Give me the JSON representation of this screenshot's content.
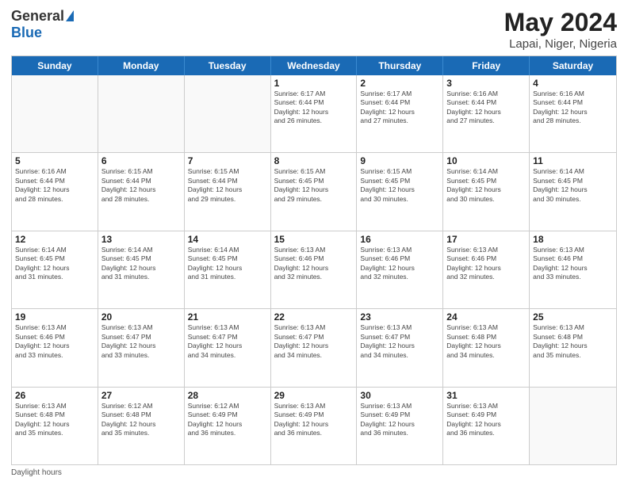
{
  "logo": {
    "general": "General",
    "blue": "Blue"
  },
  "title": "May 2024",
  "subtitle": "Lapai, Niger, Nigeria",
  "header_days": [
    "Sunday",
    "Monday",
    "Tuesday",
    "Wednesday",
    "Thursday",
    "Friday",
    "Saturday"
  ],
  "weeks": [
    [
      {
        "date": "",
        "info": ""
      },
      {
        "date": "",
        "info": ""
      },
      {
        "date": "",
        "info": ""
      },
      {
        "date": "1",
        "info": "Sunrise: 6:17 AM\nSunset: 6:44 PM\nDaylight: 12 hours\nand 26 minutes."
      },
      {
        "date": "2",
        "info": "Sunrise: 6:17 AM\nSunset: 6:44 PM\nDaylight: 12 hours\nand 27 minutes."
      },
      {
        "date": "3",
        "info": "Sunrise: 6:16 AM\nSunset: 6:44 PM\nDaylight: 12 hours\nand 27 minutes."
      },
      {
        "date": "4",
        "info": "Sunrise: 6:16 AM\nSunset: 6:44 PM\nDaylight: 12 hours\nand 28 minutes."
      }
    ],
    [
      {
        "date": "5",
        "info": "Sunrise: 6:16 AM\nSunset: 6:44 PM\nDaylight: 12 hours\nand 28 minutes."
      },
      {
        "date": "6",
        "info": "Sunrise: 6:15 AM\nSunset: 6:44 PM\nDaylight: 12 hours\nand 28 minutes."
      },
      {
        "date": "7",
        "info": "Sunrise: 6:15 AM\nSunset: 6:44 PM\nDaylight: 12 hours\nand 29 minutes."
      },
      {
        "date": "8",
        "info": "Sunrise: 6:15 AM\nSunset: 6:45 PM\nDaylight: 12 hours\nand 29 minutes."
      },
      {
        "date": "9",
        "info": "Sunrise: 6:15 AM\nSunset: 6:45 PM\nDaylight: 12 hours\nand 30 minutes."
      },
      {
        "date": "10",
        "info": "Sunrise: 6:14 AM\nSunset: 6:45 PM\nDaylight: 12 hours\nand 30 minutes."
      },
      {
        "date": "11",
        "info": "Sunrise: 6:14 AM\nSunset: 6:45 PM\nDaylight: 12 hours\nand 30 minutes."
      }
    ],
    [
      {
        "date": "12",
        "info": "Sunrise: 6:14 AM\nSunset: 6:45 PM\nDaylight: 12 hours\nand 31 minutes."
      },
      {
        "date": "13",
        "info": "Sunrise: 6:14 AM\nSunset: 6:45 PM\nDaylight: 12 hours\nand 31 minutes."
      },
      {
        "date": "14",
        "info": "Sunrise: 6:14 AM\nSunset: 6:45 PM\nDaylight: 12 hours\nand 31 minutes."
      },
      {
        "date": "15",
        "info": "Sunrise: 6:13 AM\nSunset: 6:46 PM\nDaylight: 12 hours\nand 32 minutes."
      },
      {
        "date": "16",
        "info": "Sunrise: 6:13 AM\nSunset: 6:46 PM\nDaylight: 12 hours\nand 32 minutes."
      },
      {
        "date": "17",
        "info": "Sunrise: 6:13 AM\nSunset: 6:46 PM\nDaylight: 12 hours\nand 32 minutes."
      },
      {
        "date": "18",
        "info": "Sunrise: 6:13 AM\nSunset: 6:46 PM\nDaylight: 12 hours\nand 33 minutes."
      }
    ],
    [
      {
        "date": "19",
        "info": "Sunrise: 6:13 AM\nSunset: 6:46 PM\nDaylight: 12 hours\nand 33 minutes."
      },
      {
        "date": "20",
        "info": "Sunrise: 6:13 AM\nSunset: 6:47 PM\nDaylight: 12 hours\nand 33 minutes."
      },
      {
        "date": "21",
        "info": "Sunrise: 6:13 AM\nSunset: 6:47 PM\nDaylight: 12 hours\nand 34 minutes."
      },
      {
        "date": "22",
        "info": "Sunrise: 6:13 AM\nSunset: 6:47 PM\nDaylight: 12 hours\nand 34 minutes."
      },
      {
        "date": "23",
        "info": "Sunrise: 6:13 AM\nSunset: 6:47 PM\nDaylight: 12 hours\nand 34 minutes."
      },
      {
        "date": "24",
        "info": "Sunrise: 6:13 AM\nSunset: 6:48 PM\nDaylight: 12 hours\nand 34 minutes."
      },
      {
        "date": "25",
        "info": "Sunrise: 6:13 AM\nSunset: 6:48 PM\nDaylight: 12 hours\nand 35 minutes."
      }
    ],
    [
      {
        "date": "26",
        "info": "Sunrise: 6:13 AM\nSunset: 6:48 PM\nDaylight: 12 hours\nand 35 minutes."
      },
      {
        "date": "27",
        "info": "Sunrise: 6:12 AM\nSunset: 6:48 PM\nDaylight: 12 hours\nand 35 minutes."
      },
      {
        "date": "28",
        "info": "Sunrise: 6:12 AM\nSunset: 6:49 PM\nDaylight: 12 hours\nand 36 minutes."
      },
      {
        "date": "29",
        "info": "Sunrise: 6:13 AM\nSunset: 6:49 PM\nDaylight: 12 hours\nand 36 minutes."
      },
      {
        "date": "30",
        "info": "Sunrise: 6:13 AM\nSunset: 6:49 PM\nDaylight: 12 hours\nand 36 minutes."
      },
      {
        "date": "31",
        "info": "Sunrise: 6:13 AM\nSunset: 6:49 PM\nDaylight: 12 hours\nand 36 minutes."
      },
      {
        "date": "",
        "info": ""
      }
    ]
  ],
  "footer": {
    "daylight_label": "Daylight hours"
  }
}
